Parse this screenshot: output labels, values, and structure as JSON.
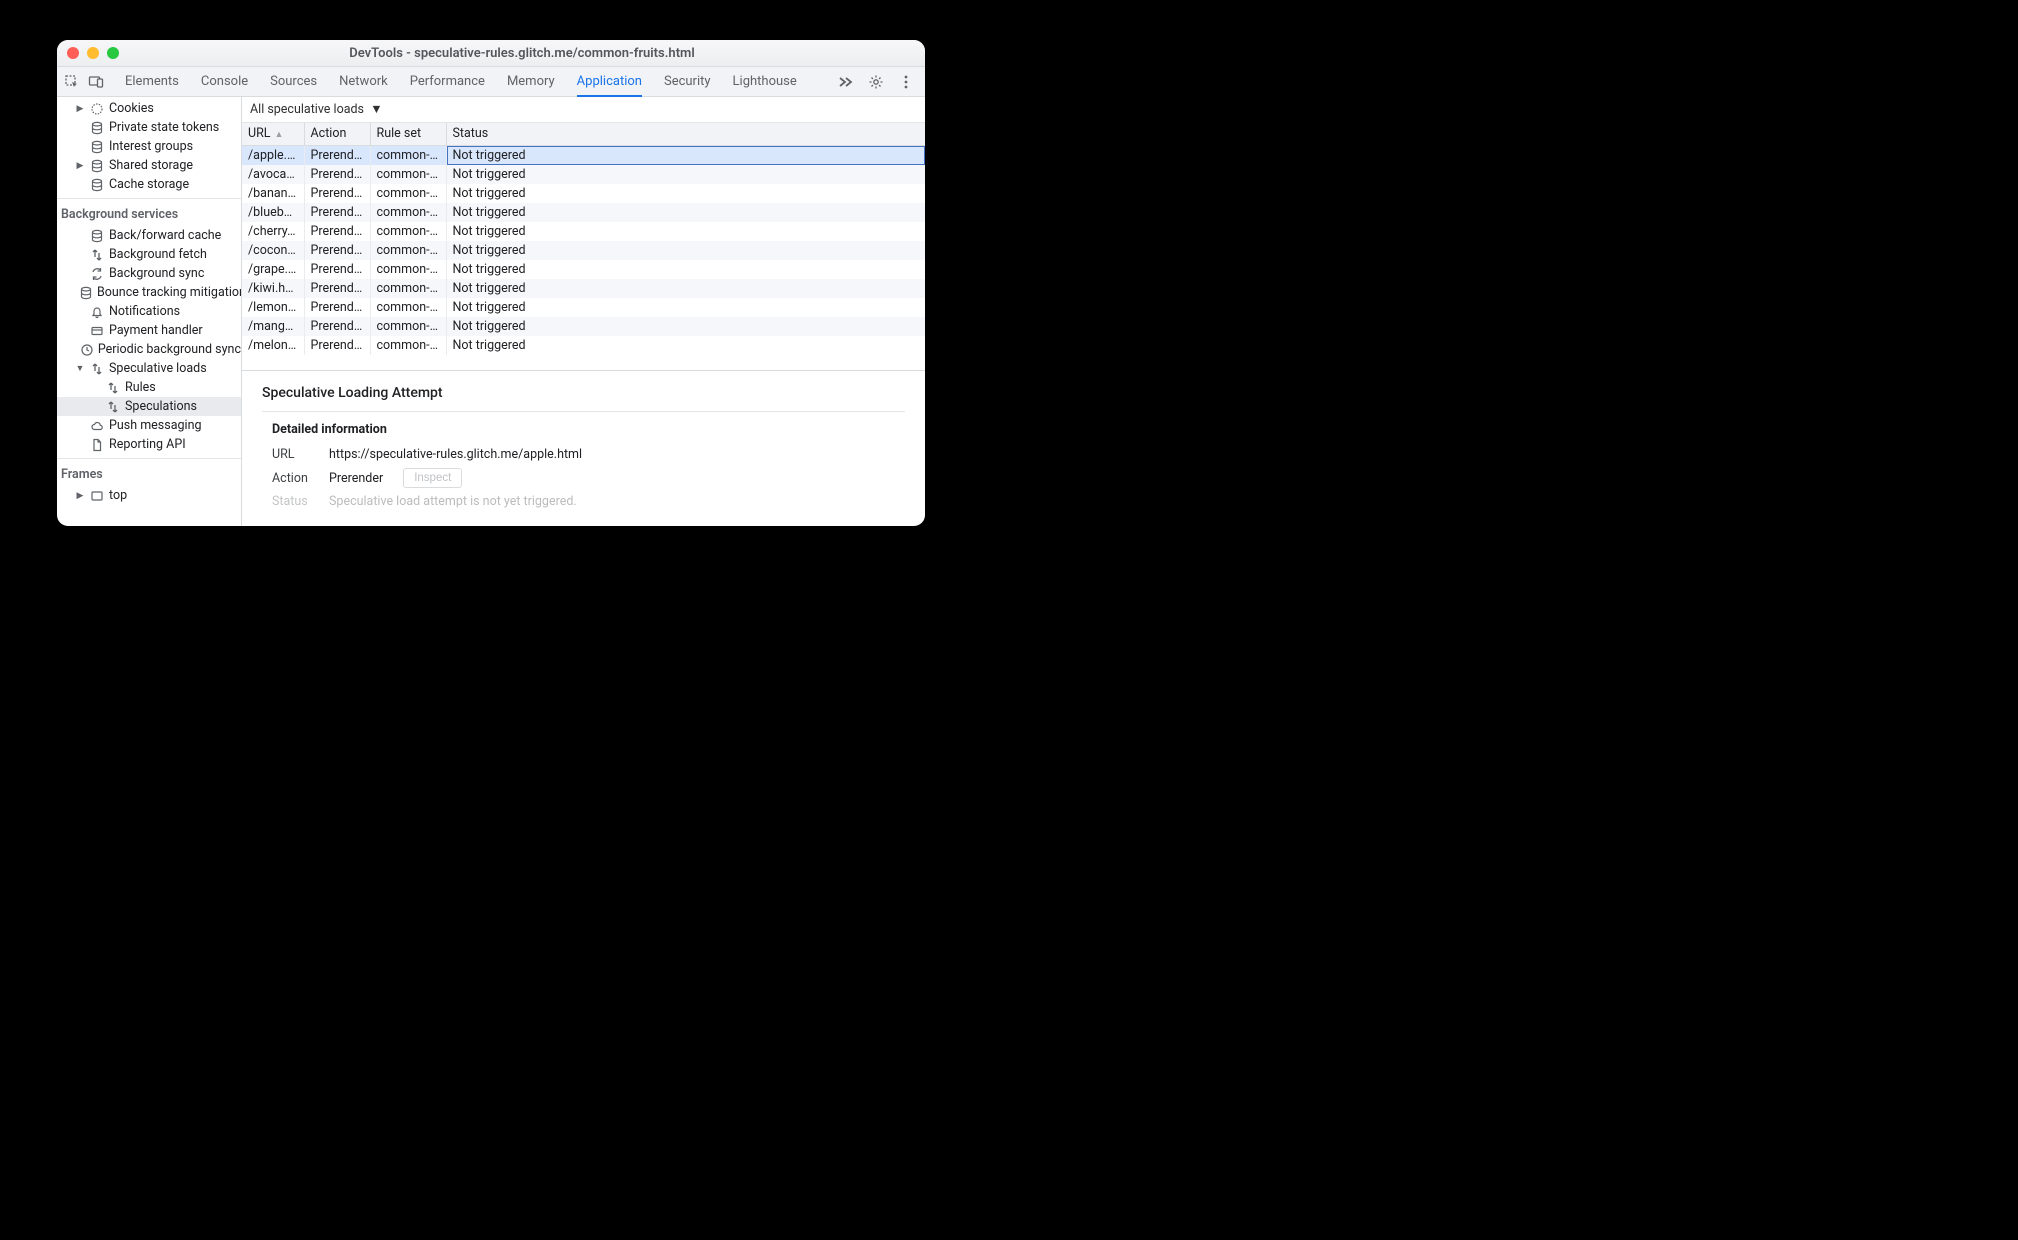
{
  "window": {
    "title": "DevTools - speculative-rules.glitch.me/common-fruits.html"
  },
  "tabs": [
    "Elements",
    "Console",
    "Sources",
    "Network",
    "Performance",
    "Memory",
    "Application",
    "Security",
    "Lighthouse"
  ],
  "active_tab": "Application",
  "sidebar": {
    "storage": [
      {
        "label": "Cookies",
        "icon": "cookie",
        "arrow": true
      },
      {
        "label": "Private state tokens",
        "icon": "db"
      },
      {
        "label": "Interest groups",
        "icon": "db"
      },
      {
        "label": "Shared storage",
        "icon": "db",
        "arrow": true
      },
      {
        "label": "Cache storage",
        "icon": "db"
      }
    ],
    "bg_heading": "Background services",
    "background": [
      {
        "label": "Back/forward cache",
        "icon": "db"
      },
      {
        "label": "Background fetch",
        "icon": "fetch"
      },
      {
        "label": "Background sync",
        "icon": "sync"
      },
      {
        "label": "Bounce tracking mitigations",
        "icon": "db"
      },
      {
        "label": "Notifications",
        "icon": "bell"
      },
      {
        "label": "Payment handler",
        "icon": "card"
      },
      {
        "label": "Periodic background sync",
        "icon": "clock"
      },
      {
        "label": "Speculative loads",
        "icon": "fetch",
        "arrow": "open",
        "children": [
          {
            "label": "Rules",
            "icon": "fetch"
          },
          {
            "label": "Speculations",
            "icon": "fetch",
            "selected": true
          }
        ]
      },
      {
        "label": "Push messaging",
        "icon": "cloud"
      },
      {
        "label": "Reporting API",
        "icon": "doc"
      }
    ],
    "frames_heading": "Frames",
    "frames": [
      {
        "label": "top",
        "icon": "frame",
        "arrow": true
      }
    ]
  },
  "filter": {
    "label": "All speculative loads"
  },
  "columns": [
    "URL",
    "Action",
    "Rule set",
    "Status"
  ],
  "rows": [
    {
      "url": "/apple.html",
      "action": "Prerender",
      "ruleset": "common-fr…",
      "status": "Not triggered",
      "selected": true
    },
    {
      "url": "/avocad…",
      "action": "Prerender",
      "ruleset": "common-fr…",
      "status": "Not triggered"
    },
    {
      "url": "/banana.…",
      "action": "Prerender",
      "ruleset": "common-fr…",
      "status": "Not triggered"
    },
    {
      "url": "/blueberr…",
      "action": "Prerender",
      "ruleset": "common-fr…",
      "status": "Not triggered"
    },
    {
      "url": "/cherry.h…",
      "action": "Prerender",
      "ruleset": "common-fr…",
      "status": "Not triggered"
    },
    {
      "url": "/coconut…",
      "action": "Prerender",
      "ruleset": "common-fr…",
      "status": "Not triggered"
    },
    {
      "url": "/grape.html",
      "action": "Prerender",
      "ruleset": "common-fr…",
      "status": "Not triggered"
    },
    {
      "url": "/kiwi.html",
      "action": "Prerender",
      "ruleset": "common-fr…",
      "status": "Not triggered"
    },
    {
      "url": "/lemon.h…",
      "action": "Prerender",
      "ruleset": "common-fr…",
      "status": "Not triggered"
    },
    {
      "url": "/mango.…",
      "action": "Prerender",
      "ruleset": "common-fr…",
      "status": "Not triggered"
    },
    {
      "url": "/melon.h…",
      "action": "Prerender",
      "ruleset": "common-fr…",
      "status": "Not triggered"
    }
  ],
  "detail": {
    "title": "Speculative Loading Attempt",
    "section": "Detailed information",
    "url_label": "URL",
    "url_value": "https://speculative-rules.glitch.me/apple.html",
    "action_label": "Action",
    "action_value": "Prerender",
    "inspect_label": "Inspect",
    "status_label": "Status",
    "status_value": "Speculative load attempt is not yet triggered."
  }
}
